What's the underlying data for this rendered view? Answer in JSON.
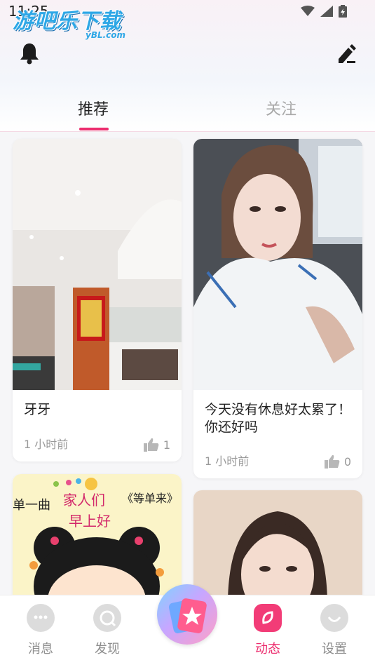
{
  "status_bar": {
    "time": "11:25"
  },
  "watermark": {
    "cn": "游吧乐下载",
    "en": "yBL.com"
  },
  "tabs": [
    {
      "label": "推荐",
      "active": true
    },
    {
      "label": "关注",
      "active": false
    }
  ],
  "cards": [
    {
      "title": "牙牙",
      "time": "1 小时前",
      "likes": "1",
      "image": "clinic reception interior photo"
    },
    {
      "title": "今天没有休息好太累了！你还好吗",
      "time": "1 小时前",
      "likes": "0",
      "image": "selfie of woman in white protective suit"
    },
    {
      "title": "",
      "time": "",
      "likes": "",
      "image": "cartoon girl 家人们 早上好 greeting picture"
    },
    {
      "title": "",
      "time": "",
      "likes": "",
      "image": "portrait of woman with long dark hair"
    }
  ],
  "bottom_nav": [
    {
      "label": "消息",
      "icon": "chat-icon"
    },
    {
      "label": "发现",
      "icon": "discover-icon"
    },
    {
      "label": "",
      "icon": "publish-star-icon"
    },
    {
      "label": "动态",
      "icon": "moments-icon",
      "active": true
    },
    {
      "label": "设置",
      "icon": "settings-icon"
    }
  ],
  "colors": {
    "accent": "#ec2d6e",
    "inactive": "#8e8e8e"
  }
}
